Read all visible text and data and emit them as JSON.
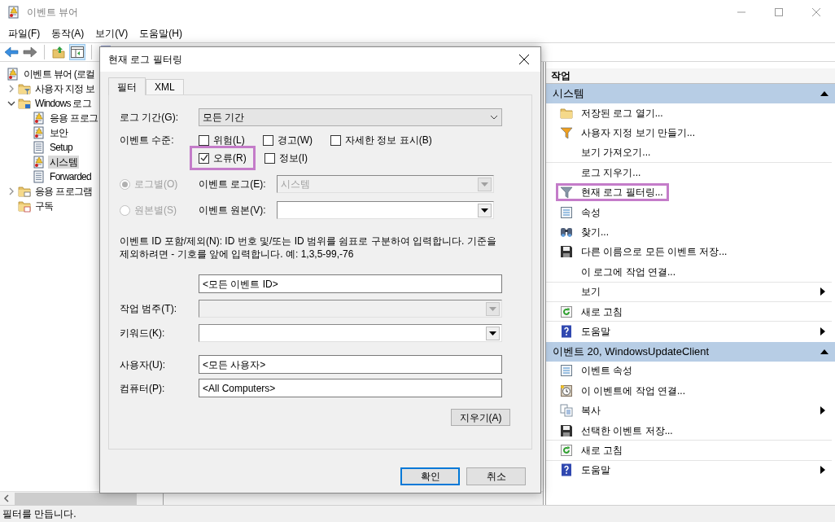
{
  "window": {
    "title": "이벤트 뷰어"
  },
  "menu": [
    "파일(F)",
    "동작(A)",
    "보기(V)",
    "도움말(H)"
  ],
  "tree": [
    {
      "label": "이벤트 뷰어 (로컬",
      "kind": "log",
      "selected": false,
      "children": [
        {
          "label": "사용자 지정 보",
          "kind": "filter-folder",
          "expanded": false,
          "selected": false
        },
        {
          "label": "Windows 로그",
          "kind": "windows-folder",
          "expanded": true,
          "selected": false,
          "children": [
            {
              "label": "응용 프로그",
              "kind": "log",
              "selected": false
            },
            {
              "label": "보안",
              "kind": "log",
              "selected": false
            },
            {
              "label": "Setup",
              "kind": "plain-log",
              "selected": false
            },
            {
              "label": "시스템",
              "kind": "system-log",
              "selected": true
            },
            {
              "label": "Forwarded",
              "kind": "plain-log",
              "selected": false
            }
          ]
        },
        {
          "label": "응용 프로그램",
          "kind": "app-folder",
          "expanded": false,
          "selected": false
        },
        {
          "label": "구독",
          "kind": "subscription-folder",
          "selected": false
        }
      ]
    }
  ],
  "actions": {
    "title": "작업",
    "sections": [
      {
        "title": "시스템",
        "expanded": true,
        "items": [
          {
            "label": "저장된 로그 열기...",
            "kind": "folder",
            "submenu": false,
            "divider": false,
            "highlighted": false
          },
          {
            "label": "사용자 지정 보기 만들기...",
            "kind": "filter",
            "submenu": false,
            "divider": false,
            "highlighted": false
          },
          {
            "label": "보기 가져오기...",
            "kind": "none",
            "submenu": false,
            "divider": true,
            "highlighted": false
          },
          {
            "label": "로그 지우기...",
            "kind": "none",
            "submenu": false,
            "divider": false,
            "highlighted": false
          },
          {
            "label": "현재 로그 필터링...",
            "kind": "filter-gray",
            "submenu": false,
            "divider": false,
            "highlighted": true
          },
          {
            "label": "속성",
            "kind": "properties",
            "submenu": false,
            "divider": false,
            "highlighted": false
          },
          {
            "label": "찾기...",
            "kind": "binoculars",
            "submenu": false,
            "divider": false,
            "highlighted": false
          },
          {
            "label": "다른 이름으로 모든 이벤트 저장...",
            "kind": "save",
            "submenu": false,
            "divider": false,
            "highlighted": false
          },
          {
            "label": "이 로그에 작업 연결...",
            "kind": "none",
            "submenu": false,
            "divider": true,
            "highlighted": false
          },
          {
            "label": "보기",
            "kind": "none",
            "submenu": true,
            "divider": true,
            "highlighted": false
          },
          {
            "label": "새로 고침",
            "kind": "refresh",
            "submenu": false,
            "divider": true,
            "highlighted": false
          },
          {
            "label": "도움말",
            "kind": "help",
            "submenu": true,
            "divider": false,
            "highlighted": false
          }
        ]
      },
      {
        "title": "이벤트 20, WindowsUpdateClient",
        "expanded": true,
        "items": [
          {
            "label": "이벤트 속성",
            "kind": "properties",
            "submenu": false,
            "divider": false,
            "highlighted": false
          },
          {
            "label": "이 이벤트에 작업 연결...",
            "kind": "clock",
            "submenu": false,
            "divider": false,
            "highlighted": false
          },
          {
            "label": "복사",
            "kind": "copy",
            "submenu": true,
            "divider": false,
            "highlighted": false
          },
          {
            "label": "선택한 이벤트 저장...",
            "kind": "save",
            "submenu": false,
            "divider": true,
            "highlighted": false
          },
          {
            "label": "새로 고침",
            "kind": "refresh",
            "submenu": false,
            "divider": true,
            "highlighted": false
          },
          {
            "label": "도움말",
            "kind": "help",
            "submenu": true,
            "divider": false,
            "highlighted": false
          }
        ]
      }
    ]
  },
  "dialog": {
    "title": "현재 로그 필터링",
    "tabs": [
      {
        "label": "필터",
        "selected": true
      },
      {
        "label": "XML",
        "selected": false
      }
    ],
    "log_period": {
      "label": "로그 기간(G):",
      "value": "모든 기간"
    },
    "event_level": {
      "label": "이벤트 수준:",
      "rows": [
        [
          {
            "label": "위험(L)",
            "checked": false,
            "highlighted": false
          },
          {
            "label": "경고(W)",
            "checked": false,
            "highlighted": false
          },
          {
            "label": "자세한 정보 표시(B)",
            "checked": false,
            "highlighted": false
          }
        ],
        [
          {
            "label": "오류(R)",
            "checked": true,
            "highlighted": true
          },
          {
            "label": "정보(I)",
            "checked": false,
            "highlighted": false
          }
        ]
      ]
    },
    "source_mode": [
      {
        "label": "로그별(O)",
        "selected": true,
        "disabled": true,
        "field_label": "이벤트 로그(E):",
        "value": "시스템",
        "field_disabled": true
      },
      {
        "label": "원본별(S)",
        "selected": false,
        "disabled": true,
        "field_label": "이벤트 원본(V):",
        "field_disabled": false
      }
    ],
    "event_id": {
      "description": "이벤트 ID 포함/제외(N): ID 번호 및/또는 ID 범위를 쉼표로 구분하여 입력합니다. 기준을 제외하려면 - 기호를 앞에 입력합니다. 예: 1,3,5-99,-76",
      "value": "<모든 이벤트 ID>"
    },
    "task_category": {
      "label": "작업 범주(T):",
      "disabled": true
    },
    "keywords": {
      "label": "키워드(K):",
      "disabled": false
    },
    "user": {
      "label": "사용자(U):",
      "value": "<모든 사용자>"
    },
    "computer": {
      "label": "컴퓨터(P):",
      "value": "<All Computers>"
    },
    "clear_button": "지우기(A)",
    "buttons": [
      {
        "label": "확인",
        "default": true
      },
      {
        "label": "취소",
        "default": false
      }
    ]
  },
  "status_bar": "필터를 만듭니다."
}
